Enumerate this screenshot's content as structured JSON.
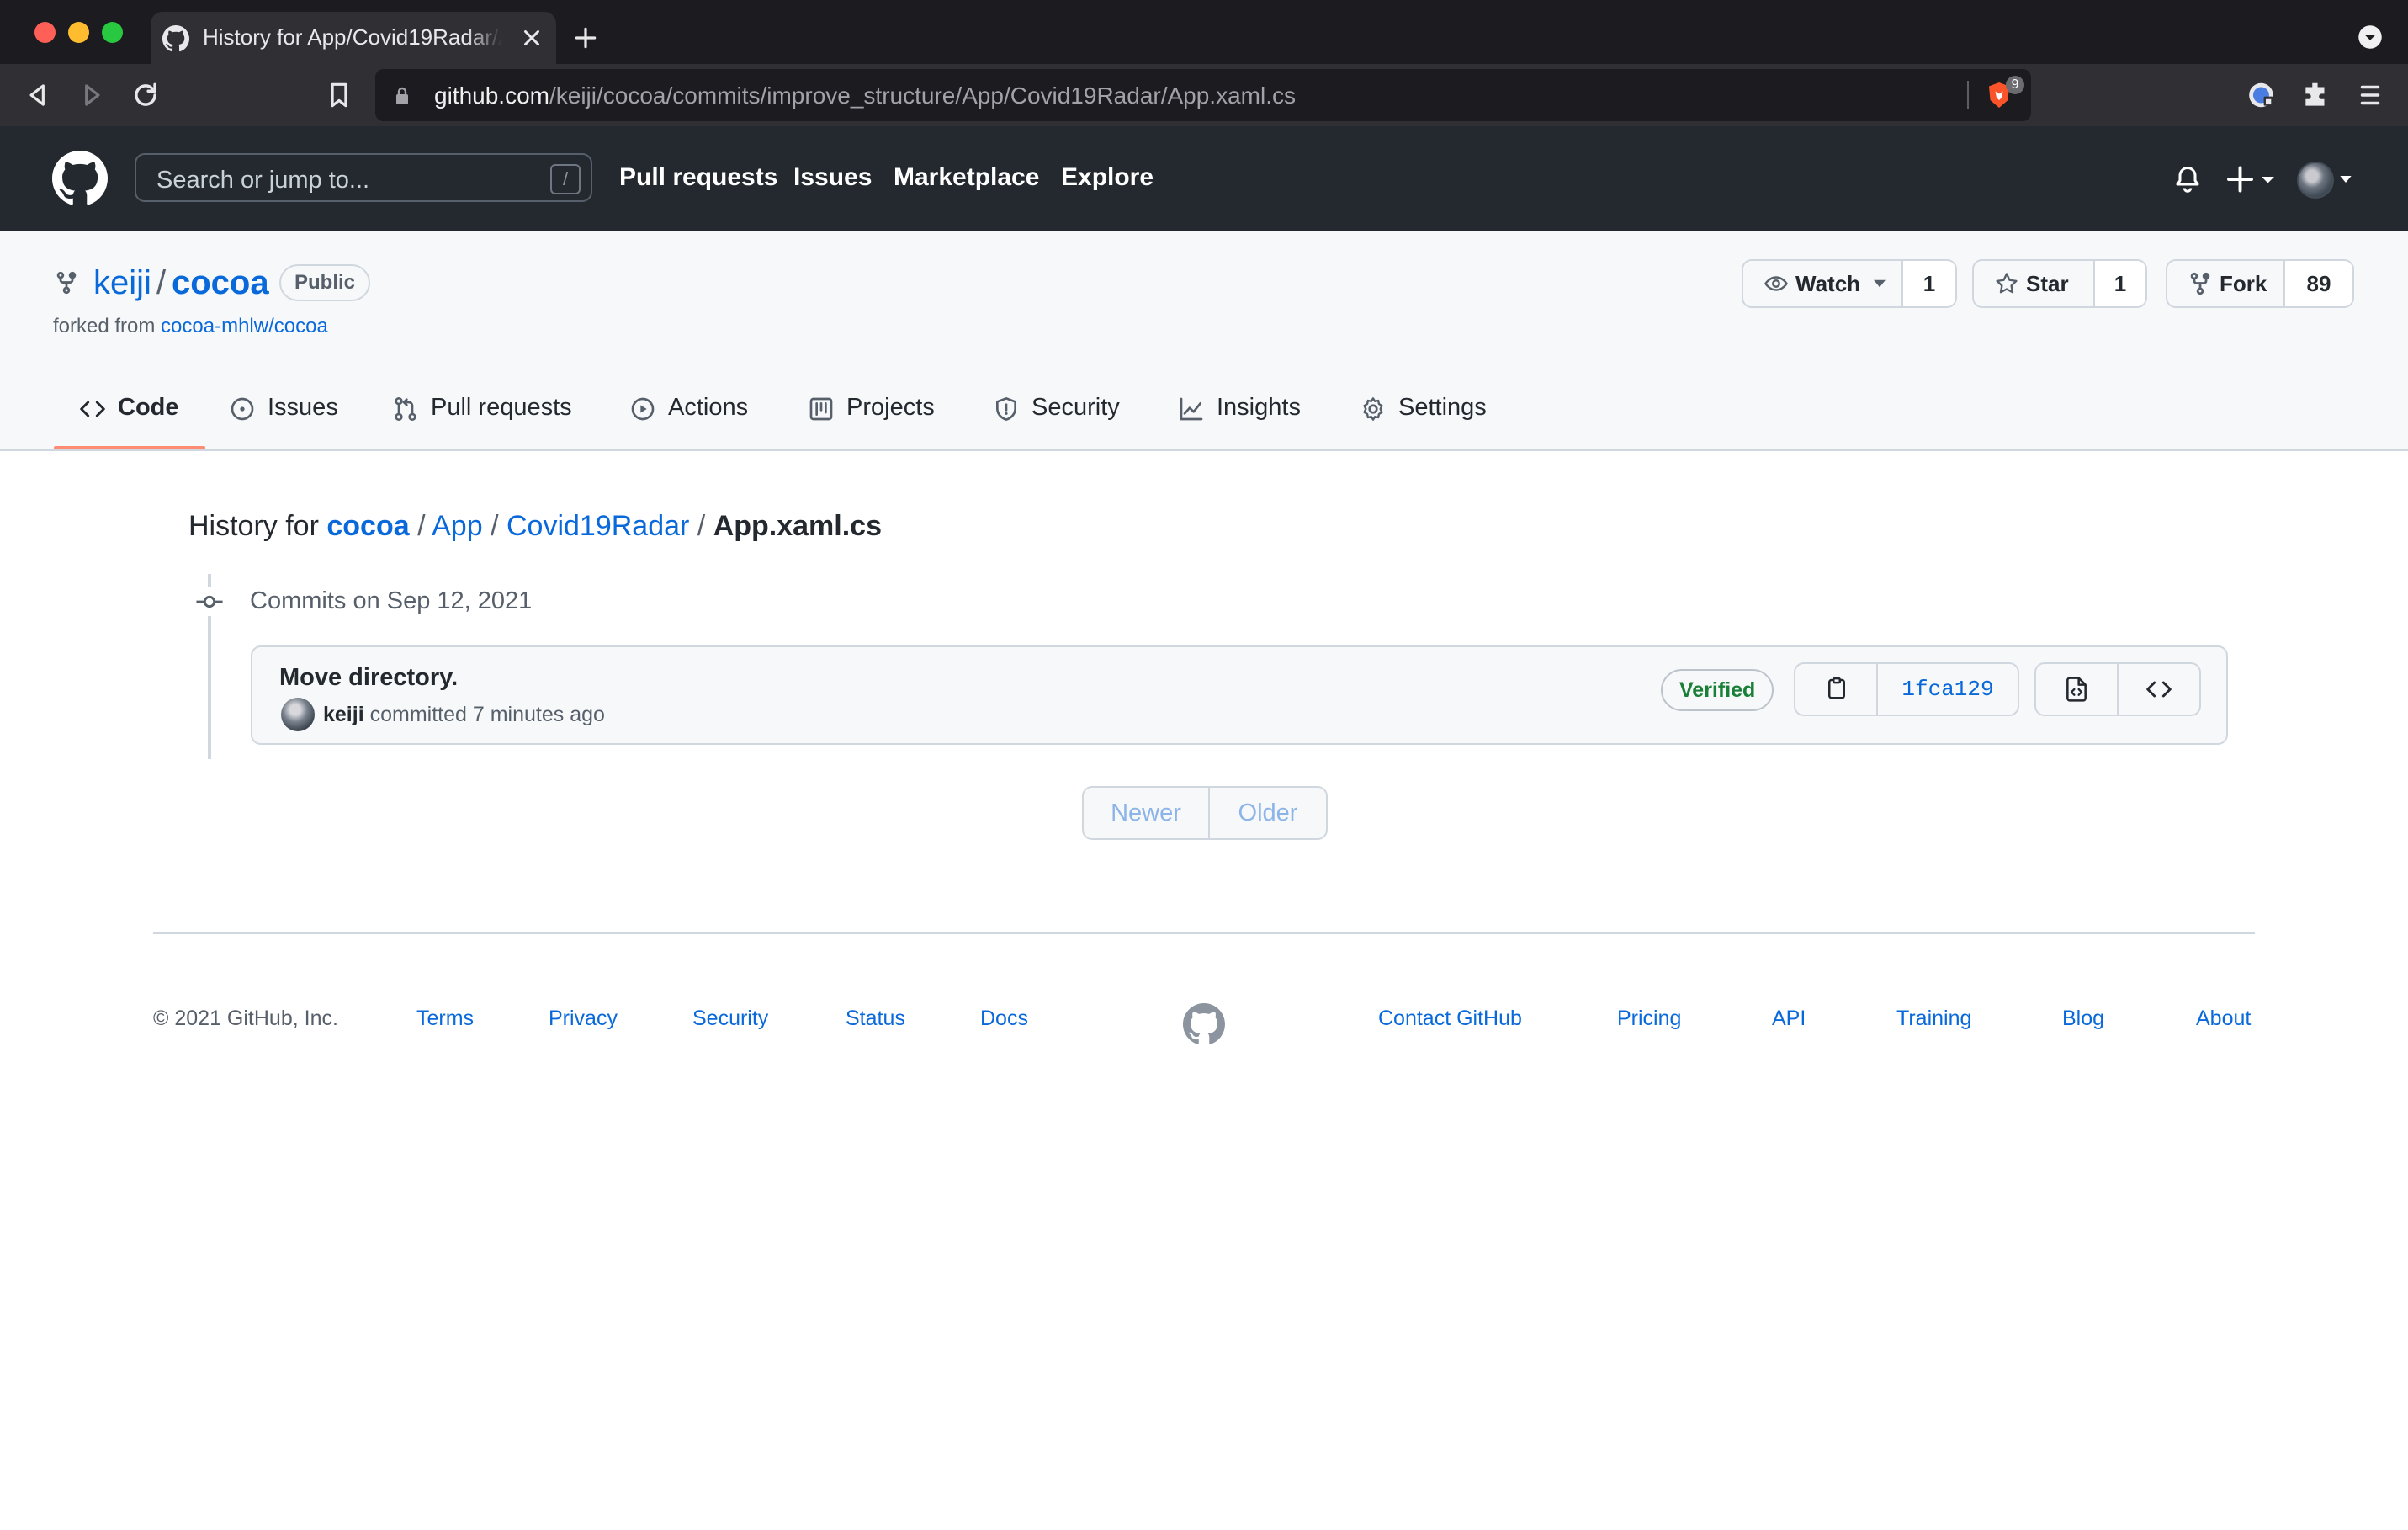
{
  "browser": {
    "tab_title": "History for App/Covid19Radar/App.xaml.cs",
    "url_host": "github.com",
    "url_path": "/keiji/cocoa/commits/improve_structure/App/Covid19Radar/App.xaml.cs",
    "brave_badge": "9"
  },
  "github_header": {
    "search_placeholder": "Search or jump to...",
    "search_shortcut": "/",
    "nav": [
      "Pull requests",
      "Issues",
      "Marketplace",
      "Explore"
    ]
  },
  "repo": {
    "owner": "keiji",
    "slash": "/",
    "name": "cocoa",
    "visibility": "Public",
    "forked_from_label": "forked from",
    "forked_from": "cocoa-mhlw/cocoa",
    "watch_label": "Watch",
    "watch_count": "1",
    "star_label": "Star",
    "star_count": "1",
    "fork_label": "Fork",
    "fork_count": "89"
  },
  "repo_tabs": [
    "Code",
    "Issues",
    "Pull requests",
    "Actions",
    "Projects",
    "Security",
    "Insights",
    "Settings"
  ],
  "active_tab": "Code",
  "history": {
    "prefix": "History for",
    "crumbs": [
      "cocoa",
      "App",
      "Covid19Radar"
    ],
    "file": "App.xaml.cs",
    "sep": "/"
  },
  "commit_group": {
    "date_label": "Commits on Sep 12, 2021",
    "commits": [
      {
        "message": "Move directory.",
        "author": "keiji",
        "action": "committed",
        "time": "7 minutes ago",
        "badge": "Verified",
        "sha": "1fca129"
      }
    ]
  },
  "pagination": {
    "newer": "Newer",
    "older": "Older"
  },
  "footer": {
    "copyright": "© 2021 GitHub, Inc.",
    "left_links": [
      "Terms",
      "Privacy",
      "Security",
      "Status",
      "Docs"
    ],
    "right_links": [
      "Contact GitHub",
      "Pricing",
      "API",
      "Training",
      "Blog",
      "About"
    ]
  },
  "colors": {
    "header_bg": "#24292f",
    "link": "#0969da",
    "verified": "#1a7f37",
    "active_tab_underline": "#fd8c73"
  }
}
